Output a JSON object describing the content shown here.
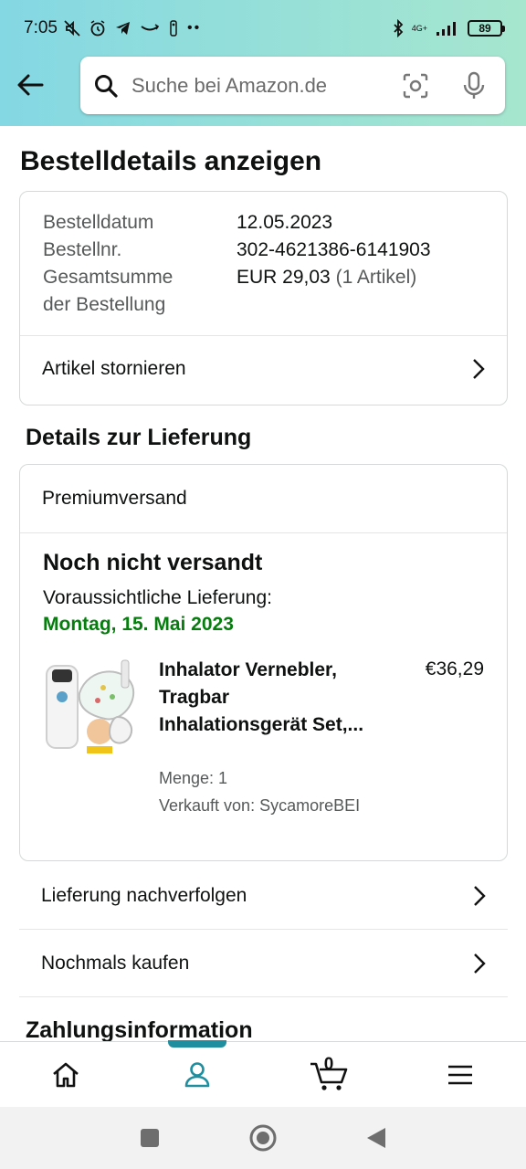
{
  "status_bar": {
    "time": "7:05",
    "network": "4G+",
    "battery": "89"
  },
  "header": {
    "search_placeholder": "Suche bei Amazon.de"
  },
  "page": {
    "title": "Bestelldetails anzeigen",
    "order": {
      "date_label": "Bestelldatum",
      "date_value": "12.05.2023",
      "number_label": "Bestellnr.",
      "number_value": "302-4621386-6141903",
      "total_label_1": "Gesamtsumme",
      "total_label_2": "der Bestellung",
      "total_value": "EUR 29,03",
      "total_items": "(1 Artikel)",
      "cancel_link": "Artikel stornieren"
    },
    "delivery": {
      "section_title": "Details zur Lieferung",
      "shipping_type": "Premiumversand",
      "status": "Noch nicht versandt",
      "eta_label": "Voraussichtliche Lieferung:",
      "eta_date": "Montag, 15. Mai 2023",
      "product": {
        "title": "Inhalator Vernebler, Tragbar Inhalationsgerät Set,...",
        "price": "€36,29",
        "quantity": "Menge: 1",
        "seller": "Verkauft von: SycamoreBEI"
      }
    },
    "actions": {
      "track": "Lieferung nachverfolgen",
      "buy_again": "Nochmals kaufen"
    },
    "payment_section_title": "Zahlungsinformation"
  },
  "bottom_nav": {
    "items": [
      {
        "icon": "home-icon"
      },
      {
        "icon": "account-icon",
        "active": true
      },
      {
        "icon": "cart-icon",
        "count": "0"
      },
      {
        "icon": "menu-icon"
      }
    ]
  },
  "colors": {
    "accent": "#1f8f9f",
    "delivery_green": "#067d0e",
    "header_gradient_start": "#84d8e3",
    "header_gradient_end": "#a6e6ce"
  }
}
